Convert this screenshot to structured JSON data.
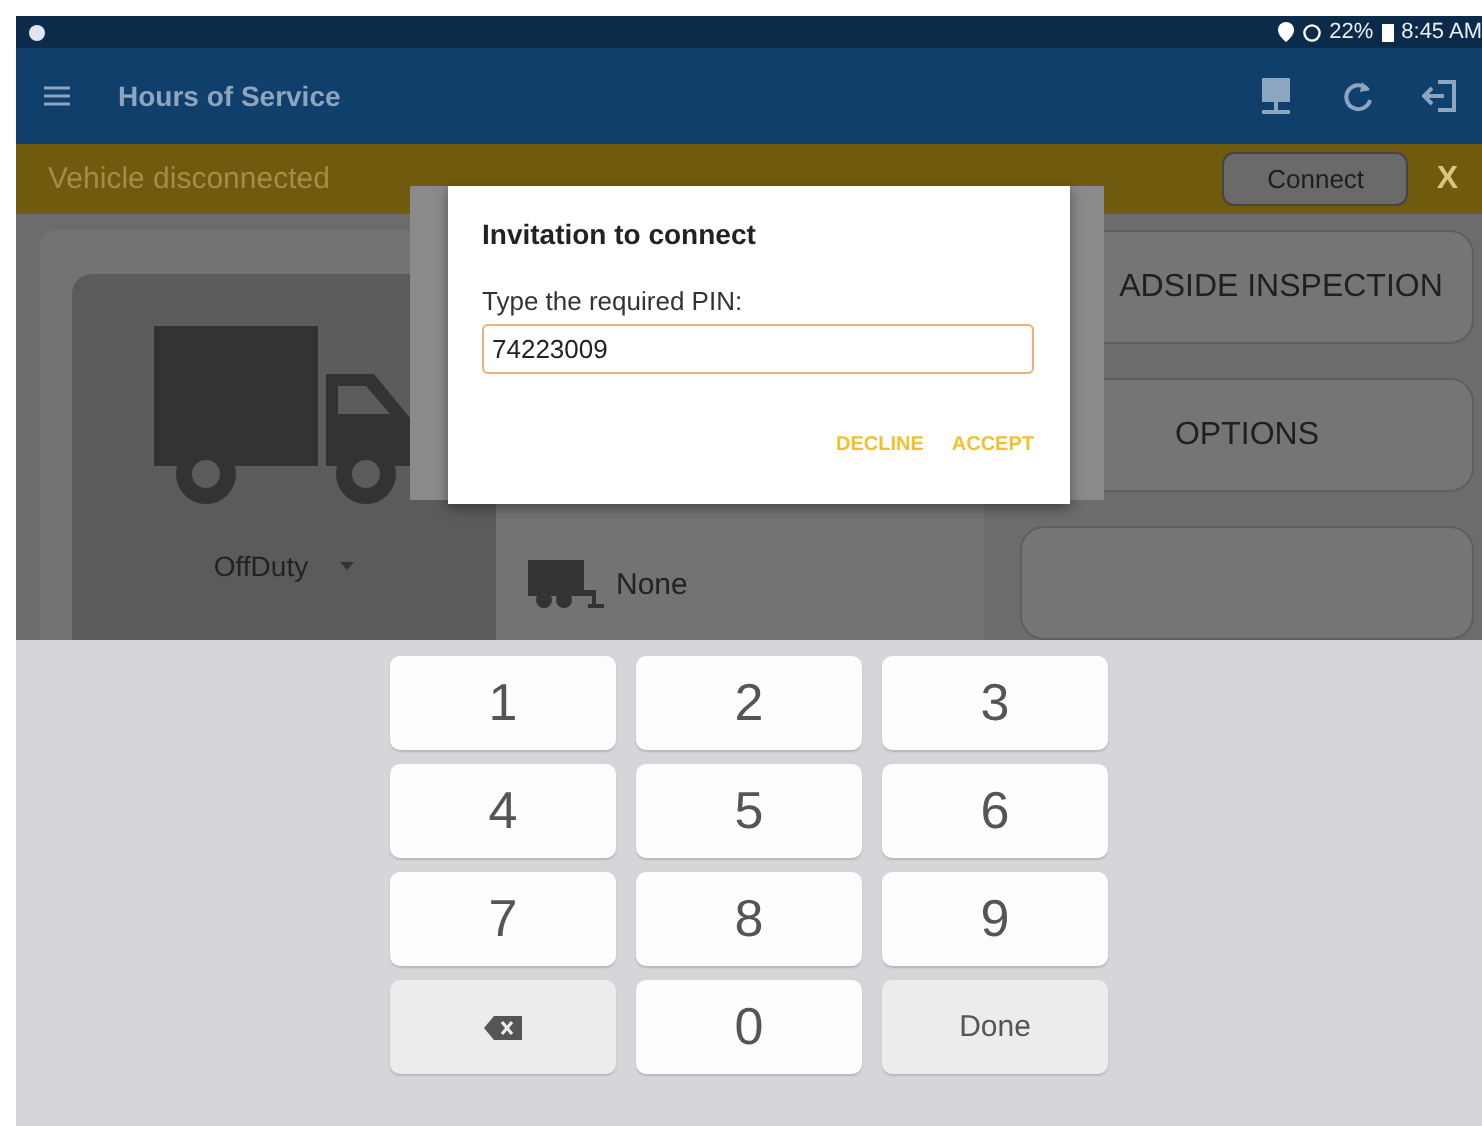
{
  "status_bar": {
    "battery": "22%",
    "time": "8:45 AM"
  },
  "app_bar": {
    "title": "Hours of Service"
  },
  "banner": {
    "message": "Vehicle disconnected",
    "connect_button": "Connect",
    "close": "X"
  },
  "status_card": {
    "duty_status": "OffDuty",
    "trailer": "None"
  },
  "menu_buttons": [
    "ADSIDE INSPECTION",
    "OPTIONS"
  ],
  "dialog": {
    "title": "Invitation to connect",
    "label": "Type the required PIN:",
    "value": "74223009",
    "buttons": [
      "DECLINE",
      "ACCEPT"
    ]
  },
  "keyboard": [
    {
      "kind": "digit",
      "label": "1"
    },
    {
      "kind": "digit",
      "label": "2"
    },
    {
      "kind": "digit",
      "label": "3"
    },
    {
      "kind": "digit",
      "label": "4"
    },
    {
      "kind": "digit",
      "label": "5"
    },
    {
      "kind": "digit",
      "label": "6"
    },
    {
      "kind": "digit",
      "label": "7"
    },
    {
      "kind": "digit",
      "label": "8"
    },
    {
      "kind": "digit",
      "label": "9"
    },
    {
      "kind": "backspace"
    },
    {
      "kind": "digit",
      "label": "0"
    },
    {
      "kind": "done",
      "label": "Done"
    }
  ]
}
